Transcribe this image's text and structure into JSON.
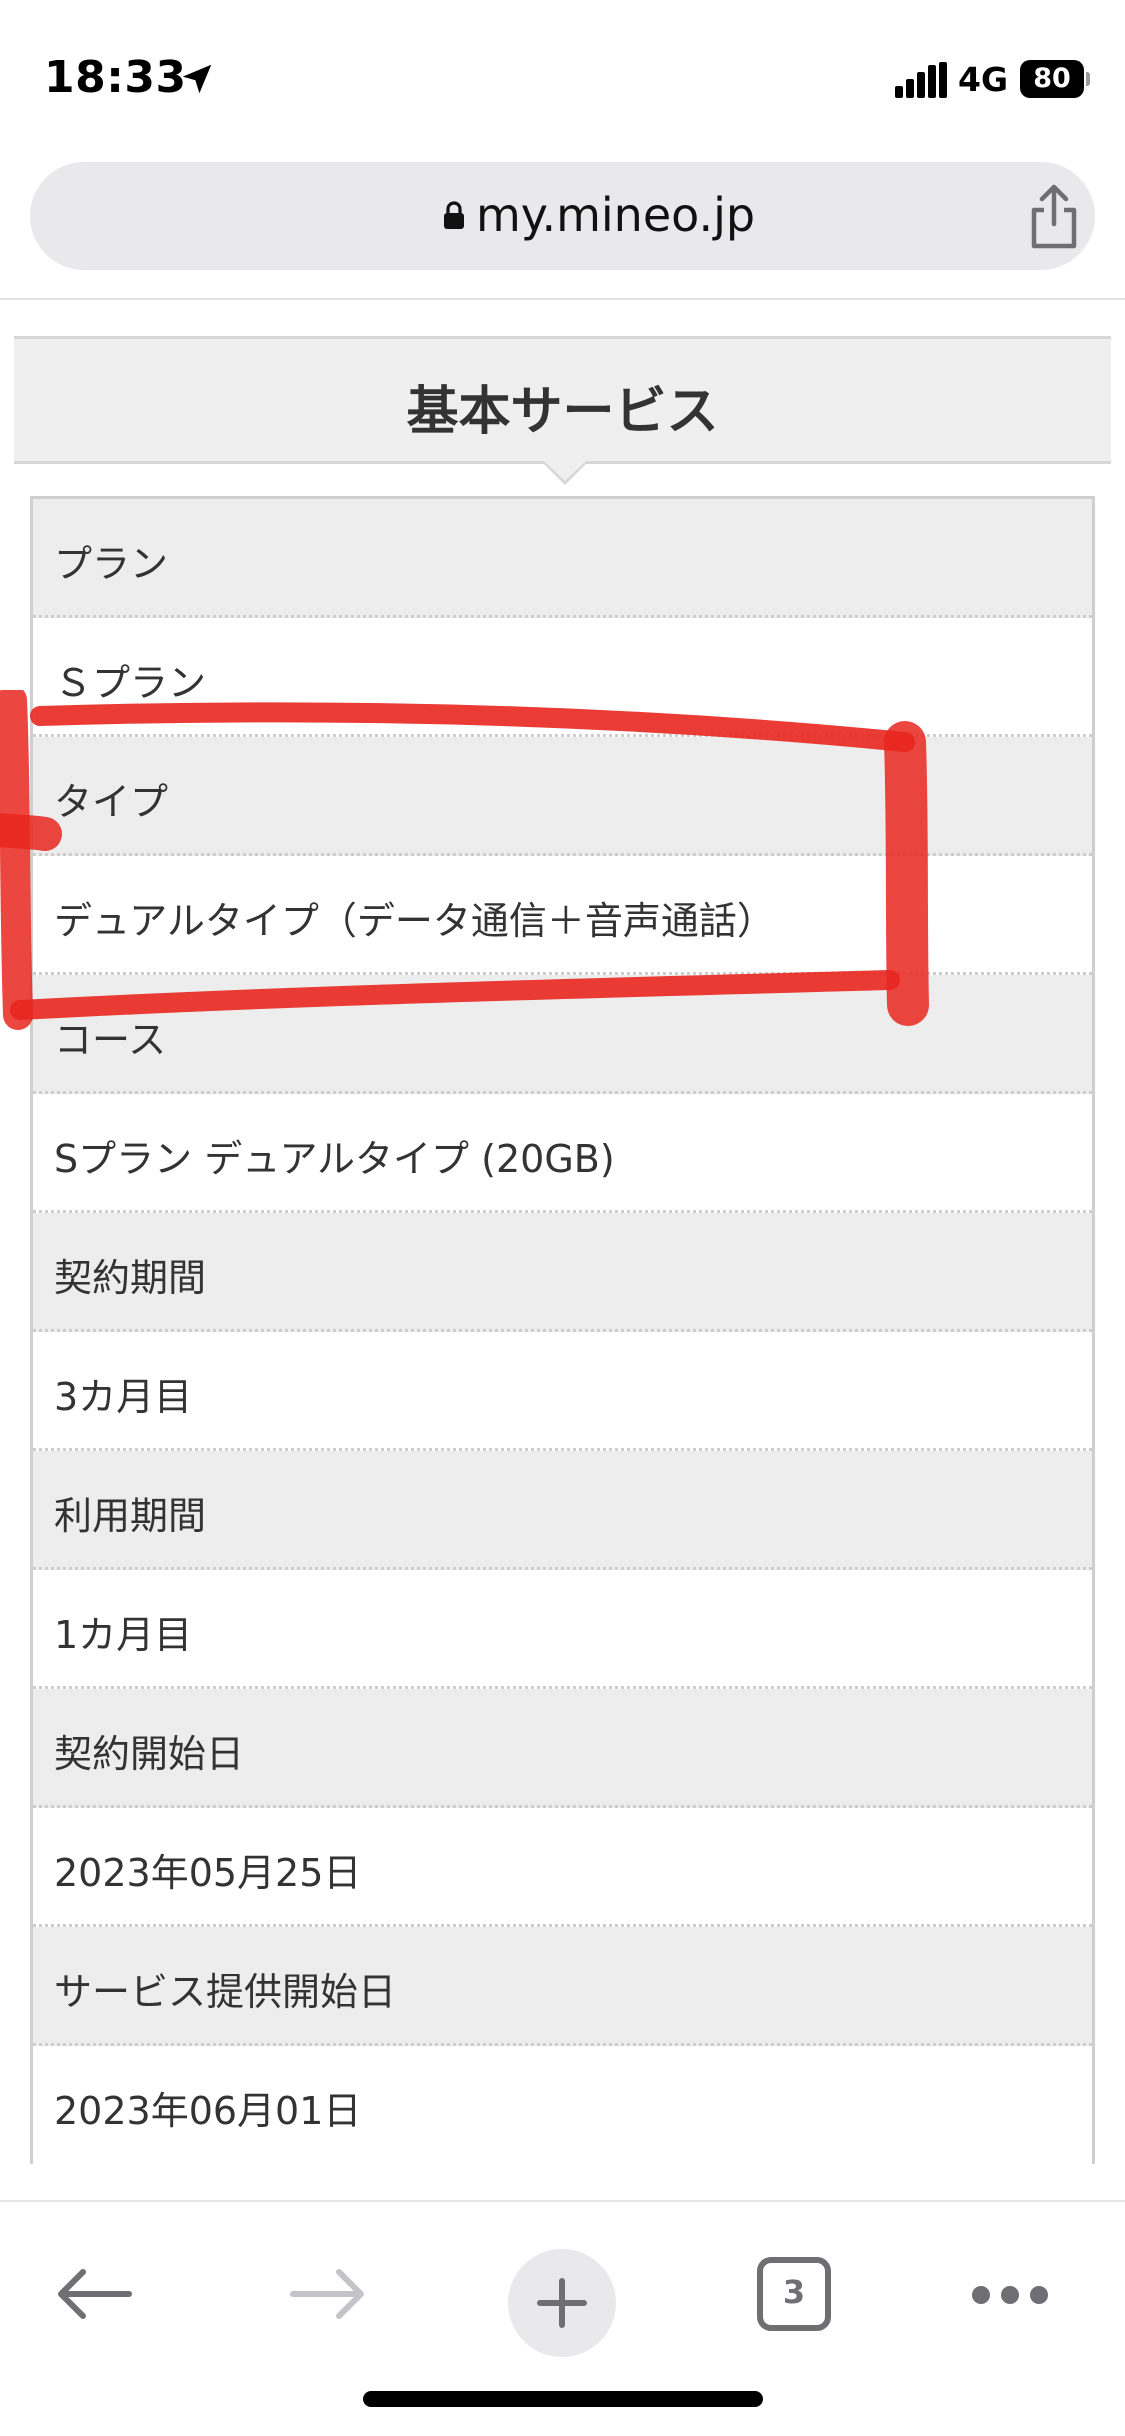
{
  "status_bar": {
    "time": "18:33",
    "network": "4G",
    "battery": "80"
  },
  "address_bar": {
    "url": "my.mineo.jp"
  },
  "section": {
    "title": "基本サービス"
  },
  "info_rows": [
    {
      "label": "プラン",
      "value": "Ｓプラン"
    },
    {
      "label": "タイプ",
      "value": "デュアルタイプ（データ通信＋音声通話）"
    },
    {
      "label": "コース",
      "value": "Sプラン デュアルタイプ (20GB)"
    },
    {
      "label": "契約期間",
      "value": "3カ月目"
    },
    {
      "label": "利用期間",
      "value": "1カ月目"
    },
    {
      "label": "契約開始日",
      "value": "2023年05月25日"
    },
    {
      "label": "サービス提供開始日",
      "value": "2023年06月01日"
    }
  ],
  "toolbar": {
    "tab_count": "3"
  },
  "colors": {
    "annotation": "#e8261f",
    "label_bg": "#ededed",
    "icon_gray": "#6e6e73"
  },
  "icons": [
    "location-arrow-icon",
    "signal-icon",
    "battery-icon",
    "lock-icon",
    "share-icon",
    "back-arrow-icon",
    "forward-arrow-icon",
    "plus-icon",
    "tabs-icon",
    "more-icon"
  ]
}
